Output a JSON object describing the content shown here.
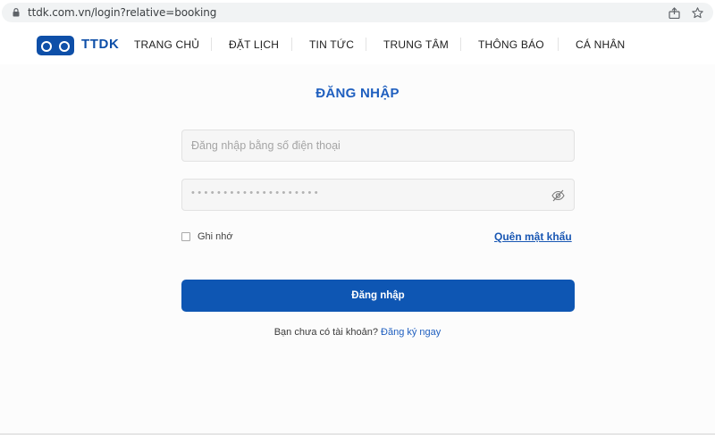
{
  "browser": {
    "url": "ttdk.com.vn/login?relative=booking",
    "lock_icon": "lock-icon",
    "share_icon": "share-icon",
    "star_icon": "star-icon"
  },
  "header": {
    "logo_text": "TTDK",
    "logo_icon": "goggles-logo-icon",
    "nav": [
      {
        "label": "TRANG CHỦ"
      },
      {
        "label": "ĐẶT LỊCH"
      },
      {
        "label": "TIN TỨC"
      },
      {
        "label": "TRUNG TÂM"
      },
      {
        "label": "THÔNG BÁO"
      },
      {
        "label": "CÁ NHÂN"
      }
    ]
  },
  "login": {
    "title": "ĐĂNG NHẬP",
    "phone_placeholder": "Đăng nhập bằng số điện thoại",
    "password_mask": "••••••••••••••••••••",
    "password_toggle_icon": "eye-off-icon",
    "remember_label": "Ghi nhớ",
    "forgot_label": "Quên mật khẩu",
    "submit_label": "Đăng nhập",
    "signup_prompt": "Bạn chưa có tài khoản?",
    "signup_link": "Đăng ký ngay"
  },
  "colors": {
    "brand": "#0e56b3",
    "title": "#1f5fbf"
  }
}
